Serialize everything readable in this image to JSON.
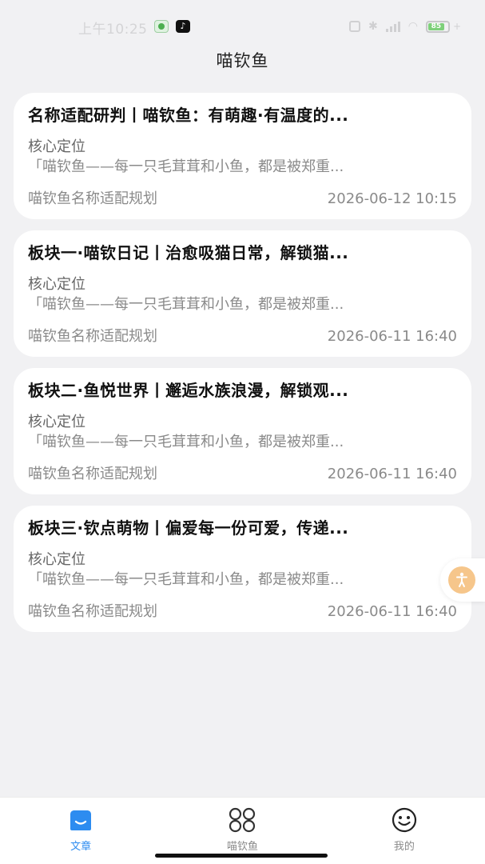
{
  "status_bar": {
    "time": "上午10:25",
    "battery": "85",
    "tiktok_icon": "♪"
  },
  "page": {
    "title": "喵钦鱼"
  },
  "articles": [
    {
      "title": "名称适配研判丨喵钦鱼：有萌趣·有温度的...",
      "label": "核心定位",
      "excerpt": "「喵钦鱼——每一只毛茸茸和小鱼，都是被郑重...",
      "source": "喵钦鱼名称适配规划",
      "date": "2026-06-12 10:15"
    },
    {
      "title": "板块一·喵钦日记丨治愈吸猫日常，解锁猫...",
      "label": "核心定位",
      "excerpt": "「喵钦鱼——每一只毛茸茸和小鱼，都是被郑重...",
      "source": "喵钦鱼名称适配规划",
      "date": "2026-06-11 16:40"
    },
    {
      "title": "板块二·鱼悦世界丨邂逅水族浪漫，解锁观...",
      "label": "核心定位",
      "excerpt": "「喵钦鱼——每一只毛茸茸和小鱼，都是被郑重...",
      "source": "喵钦鱼名称适配规划",
      "date": "2026-06-11 16:40"
    },
    {
      "title": "板块三·钦点萌物丨偏爱每一份可爱，传递...",
      "label": "核心定位",
      "excerpt": "「喵钦鱼——每一只毛茸茸和小鱼，都是被郑重...",
      "source": "喵钦鱼名称适配规划",
      "date": "2026-06-11 16:40"
    }
  ],
  "bottom_nav": [
    {
      "label": "文章",
      "icon": "article-icon",
      "active": true
    },
    {
      "label": "喵钦鱼",
      "icon": "grid-icon",
      "active": false
    },
    {
      "label": "我的",
      "icon": "smile-icon",
      "active": false
    }
  ],
  "colors": {
    "accent": "#2d8cf0",
    "background": "#f1f1f3",
    "card": "#ffffff",
    "float_button": "#f6c68b"
  }
}
